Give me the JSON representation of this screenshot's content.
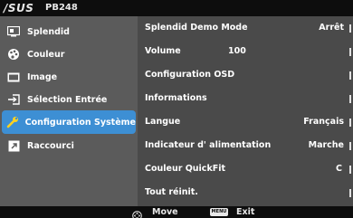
{
  "header": {
    "logo": "/SUS",
    "model": "PB248"
  },
  "sidebar": {
    "items": [
      {
        "label": "Splendid",
        "icon": "splendid-icon",
        "active": false
      },
      {
        "label": "Couleur",
        "icon": "palette-icon",
        "active": false
      },
      {
        "label": "Image",
        "icon": "image-icon",
        "active": false
      },
      {
        "label": "Sélection Entrée",
        "icon": "input-select-icon",
        "active": false
      },
      {
        "label": "Configuration Système",
        "icon": "wrench-icon",
        "active": true
      },
      {
        "label": "Raccourci",
        "icon": "shortcut-icon",
        "active": false
      }
    ]
  },
  "settings": {
    "rows": [
      {
        "label": "Splendid Demo Mode",
        "value": "Arrêt"
      },
      {
        "label": "Volume",
        "value": "100"
      },
      {
        "label": "Configuration OSD",
        "value": ""
      },
      {
        "label": "Informations",
        "value": ""
      },
      {
        "label": "Langue",
        "value": "Français"
      },
      {
        "label": "Indicateur d' alimentation",
        "value": "Marche"
      },
      {
        "label": "Couleur QuickFit",
        "value": "C"
      },
      {
        "label": "Tout réinit.",
        "value": ""
      }
    ]
  },
  "footer": {
    "move_label": "Move",
    "menu_key": "MENU",
    "exit_label": "Exit"
  },
  "colors": {
    "accent": "#3d8fd4",
    "sidebar_bg": "#5b5b5b",
    "panel_bg": "#4a4a4a",
    "bar_bg": "#0d0d0d"
  }
}
